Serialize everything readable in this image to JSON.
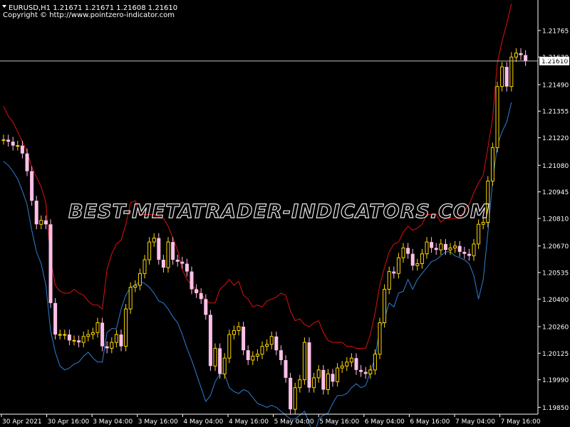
{
  "header": {
    "symbol_line": "EURUSD,H1  1.21671 1.21671 1.21608 1.21610",
    "copyright": "Copyright © http://www.pointzero-indicator.com"
  },
  "watermark": "BEST-METATRADER-INDICATORS.COM",
  "current_price_label": "1.21610",
  "colors": {
    "background": "#000000",
    "bull_candle": "#ffd700",
    "bear_candle": "#ffc0e8",
    "upper_band": "#e01010",
    "lower_band": "#2f7fd8",
    "axis": "#ffffff",
    "price_line": "#c0c0c0"
  },
  "chart_data": {
    "type": "candlestick",
    "instrument": "EURUSD",
    "timeframe": "H1",
    "ylim": [
      1.1975,
      1.2192
    ],
    "y_ticks": [
      "1.21765",
      "1.21630",
      "1.21490",
      "1.21355",
      "1.21220",
      "1.21080",
      "1.20945",
      "1.20810",
      "1.20670",
      "1.20535",
      "1.20400",
      "1.20260",
      "1.20125",
      "1.19990",
      "1.19850"
    ],
    "x_ticks": [
      "30 Apr 2021",
      "30 Apr 16:00",
      "3 May 04:00",
      "3 May 16:00",
      "4 May 04:00",
      "4 May 16:00",
      "5 May 04:00",
      "5 May 16:00",
      "6 May 04:00",
      "6 May 16:00",
      "7 May 04:00",
      "7 May 16:00"
    ],
    "last_price": 1.2161,
    "series": [
      {
        "kind": "candles",
        "close": [
          1.2121,
          1.212,
          1.2118,
          1.2118,
          1.2114,
          1.2105,
          1.209,
          1.2078,
          1.208,
          1.2078,
          1.2038,
          1.2022,
          1.2022,
          1.2022,
          1.2019,
          1.2019,
          1.2018,
          1.2021,
          1.2022,
          1.2023,
          1.2028,
          1.2016,
          1.2015,
          1.2018,
          1.2022,
          1.2016,
          1.2035,
          1.2046,
          1.2047,
          1.2053,
          1.206,
          1.2069,
          1.2071,
          1.206,
          1.2056,
          1.2069,
          1.206,
          1.2059,
          1.2058,
          1.2054,
          1.2045,
          1.2043,
          1.204,
          1.2032,
          1.2006,
          1.2015,
          1.2002,
          1.201,
          1.2022,
          1.2024,
          1.2026,
          1.2014,
          1.2009,
          1.2011,
          1.2012,
          1.2016,
          1.2017,
          1.2021,
          1.2014,
          1.2009,
          1.2,
          1.1984,
          1.1995,
          1.1999,
          1.2018,
          1.1995,
          1.2,
          1.2004,
          1.1994,
          1.2002,
          1.1998,
          1.2005,
          1.2006,
          1.2008,
          1.201,
          1.2004,
          1.2003,
          1.2002,
          1.2004,
          1.2012,
          1.2028,
          1.2045,
          1.2054,
          1.2053,
          1.2061,
          1.2066,
          1.2063,
          1.2057,
          1.2058,
          1.2063,
          1.2069,
          1.2066,
          1.2065,
          1.2068,
          1.2065,
          1.2066,
          1.2067,
          1.2064,
          1.2063,
          1.2062,
          1.2068,
          1.2078,
          1.2079,
          1.21,
          1.2117,
          1.2148,
          1.2158,
          1.2148,
          1.2163,
          1.2165,
          1.2164,
          1.2161
        ]
      },
      {
        "kind": "band",
        "name": "",
        "role": "upper",
        "values": [
          1.2138,
          1.2133,
          1.213,
          1.2125,
          1.212,
          1.2115,
          1.2107,
          1.2102,
          1.2097,
          1.2089,
          1.206,
          1.2047,
          1.2044,
          1.2043,
          1.2043,
          1.2045,
          1.2043,
          1.2042,
          1.2039,
          1.2037,
          1.2037,
          1.2035,
          1.2055,
          1.2063,
          1.2068,
          1.207,
          1.2078,
          1.2089,
          1.209,
          1.2083,
          1.2083,
          1.2083,
          1.2083,
          1.2082,
          1.2081,
          1.2077,
          1.2071,
          1.2065,
          1.2055,
          1.205,
          1.2047,
          1.2045,
          1.2043,
          1.2039,
          1.2038,
          1.2038,
          1.2045,
          1.2047,
          1.205,
          1.2047,
          1.2049,
          1.2042,
          1.204,
          1.2036,
          1.2037,
          1.2036,
          1.2039,
          1.204,
          1.2041,
          1.2043,
          1.2042,
          1.2034,
          1.2029,
          1.203,
          1.2027,
          1.2026,
          1.2028,
          1.2029,
          1.2023,
          1.2019,
          1.2018,
          1.2018,
          1.2018,
          1.2016,
          1.2016,
          1.2015,
          1.2015,
          1.2015,
          1.2022,
          1.2033,
          1.2047,
          1.2056,
          1.2064,
          1.2068,
          1.2069,
          1.2074,
          1.2077,
          1.2075,
          1.2076,
          1.2078,
          1.2083,
          1.2083,
          1.2083,
          1.2079,
          1.2081,
          1.2081,
          1.2081,
          1.2081,
          1.2085,
          1.2088,
          1.2094,
          1.2099,
          1.2103,
          1.2117,
          1.2132,
          1.216,
          1.2171,
          1.218,
          1.219
        ]
      },
      {
        "kind": "band",
        "name": "",
        "role": "lower",
        "values": [
          1.211,
          1.2108,
          1.2105,
          1.2101,
          1.2095,
          1.2088,
          1.2075,
          1.2064,
          1.2058,
          1.2047,
          1.2024,
          1.2013,
          1.2006,
          1.2004,
          1.2005,
          1.2007,
          1.2008,
          1.2011,
          1.2013,
          1.201,
          1.2008,
          1.2008,
          1.2023,
          1.2025,
          1.2025,
          1.2035,
          1.2042,
          1.2046,
          1.2047,
          1.2049,
          1.2048,
          1.2046,
          1.2043,
          1.2039,
          1.2038,
          1.2035,
          1.2031,
          1.2028,
          1.2022,
          1.2015,
          1.2009,
          1.2002,
          1.1995,
          1.1988,
          1.1991,
          1.1998,
          1.2002,
          1.2002,
          1.1995,
          1.1993,
          1.1992,
          1.1994,
          1.1993,
          1.199,
          1.1987,
          1.1986,
          1.1985,
          1.1986,
          1.1985,
          1.1983,
          1.1981,
          1.1979,
          1.1979,
          1.1981,
          1.1983,
          1.1977,
          1.197,
          1.1979,
          1.1981,
          1.1982,
          1.1987,
          1.1991,
          1.1991,
          1.1992,
          1.1995,
          1.1997,
          1.1995,
          1.1996,
          1.2003,
          1.201,
          1.2025,
          1.203,
          1.2038,
          1.2036,
          1.2043,
          1.2044,
          1.205,
          1.2045,
          1.205,
          1.2053,
          1.2056,
          1.2059,
          1.206,
          1.2062,
          1.2064,
          1.2064,
          1.2062,
          1.2061,
          1.206,
          1.2058,
          1.2052,
          1.204,
          1.205,
          1.2074,
          1.21,
          1.2118,
          1.2125,
          1.213,
          1.214
        ]
      }
    ]
  }
}
